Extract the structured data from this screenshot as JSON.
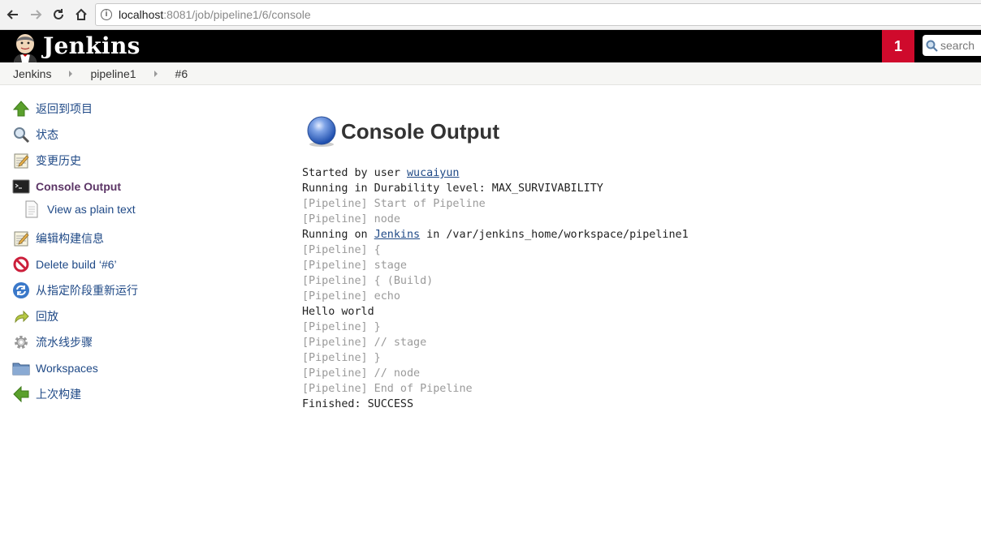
{
  "browser": {
    "url_host": "localhost",
    "url_path": ":8081/job/pipeline1/6/console"
  },
  "header": {
    "title": "Jenkins",
    "notification_count": "1",
    "search_placeholder": "search"
  },
  "breadcrumbs": [
    "Jenkins",
    "pipeline1",
    "#6"
  ],
  "sidebar": {
    "items": [
      {
        "label": "返回到项目",
        "icon": "up-arrow-icon"
      },
      {
        "label": "状态",
        "icon": "magnifier-icon"
      },
      {
        "label": "变更历史",
        "icon": "notepad-icon"
      },
      {
        "label": "Console Output",
        "icon": "terminal-icon"
      },
      {
        "label": "View as plain text",
        "icon": "document-icon"
      },
      {
        "label": "编辑构建信息",
        "icon": "notepad-icon"
      },
      {
        "label": "Delete build ‘#6’",
        "icon": "no-entry-icon"
      },
      {
        "label": "从指定阶段重新运行",
        "icon": "refresh-icon"
      },
      {
        "label": "回放",
        "icon": "replay-arrow-icon"
      },
      {
        "label": "流水线步骤",
        "icon": "gear-icon"
      },
      {
        "label": "Workspaces",
        "icon": "folder-icon"
      },
      {
        "label": "上次构建",
        "icon": "left-arrow-icon"
      }
    ]
  },
  "main": {
    "title": "Console Output",
    "console": {
      "started_by_prefix": "Started by user ",
      "started_by_user": "wucaiyun",
      "durability": "Running in Durability level: MAX_SURVIVABILITY",
      "pl_start": "[Pipeline] Start of Pipeline",
      "pl_node": "[Pipeline] node",
      "running_on_prefix": "Running on ",
      "running_on_node": "Jenkins",
      "running_on_suffix": " in /var/jenkins_home/workspace/pipeline1",
      "pl_open1": "[Pipeline] {",
      "pl_stage": "[Pipeline] stage",
      "pl_open_build": "[Pipeline] { (Build)",
      "pl_echo": "[Pipeline] echo",
      "hello": "Hello world",
      "pl_close1": "[Pipeline] }",
      "pl_end_stage": "[Pipeline] // stage",
      "pl_close2": "[Pipeline] }",
      "pl_end_node": "[Pipeline] // node",
      "pl_end": "[Pipeline] End of Pipeline",
      "finished": "Finished: SUCCESS"
    }
  }
}
